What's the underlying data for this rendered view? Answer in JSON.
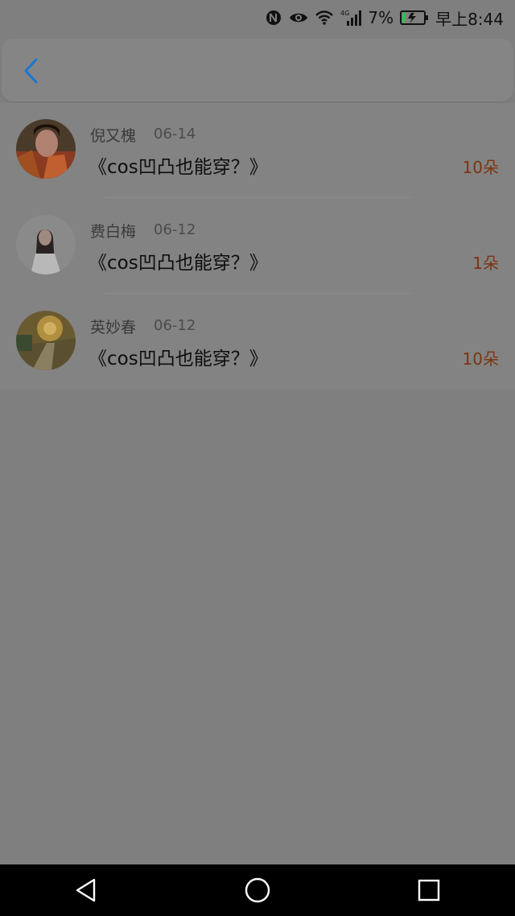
{
  "status_bar": {
    "icons": [
      "nfc-icon",
      "eye-comfort-icon",
      "wifi-icon",
      "4g-signal-icon",
      "battery-charging-icon"
    ],
    "network": "4G",
    "battery_text": "7%",
    "time": "早上8:44",
    "battery_color": "#2fbf5a"
  },
  "header": {
    "back_icon": "chevron-left-icon",
    "accent": "#1976d2"
  },
  "list": [
    {
      "name": "倪又槐",
      "date": "06-14",
      "title": "《cos凹凸也能穿？》",
      "amount": "10朵"
    },
    {
      "name": "费白梅",
      "date": "06-12",
      "title": "《cos凹凸也能穿？》",
      "amount": "1朵"
    },
    {
      "name": "英妙春",
      "date": "06-12",
      "title": "《cos凹凸也能穿？》",
      "amount": "10朵"
    }
  ],
  "nav_bar": {
    "back": "back-triangle-icon",
    "home": "home-circle-icon",
    "recents": "recents-square-icon"
  }
}
